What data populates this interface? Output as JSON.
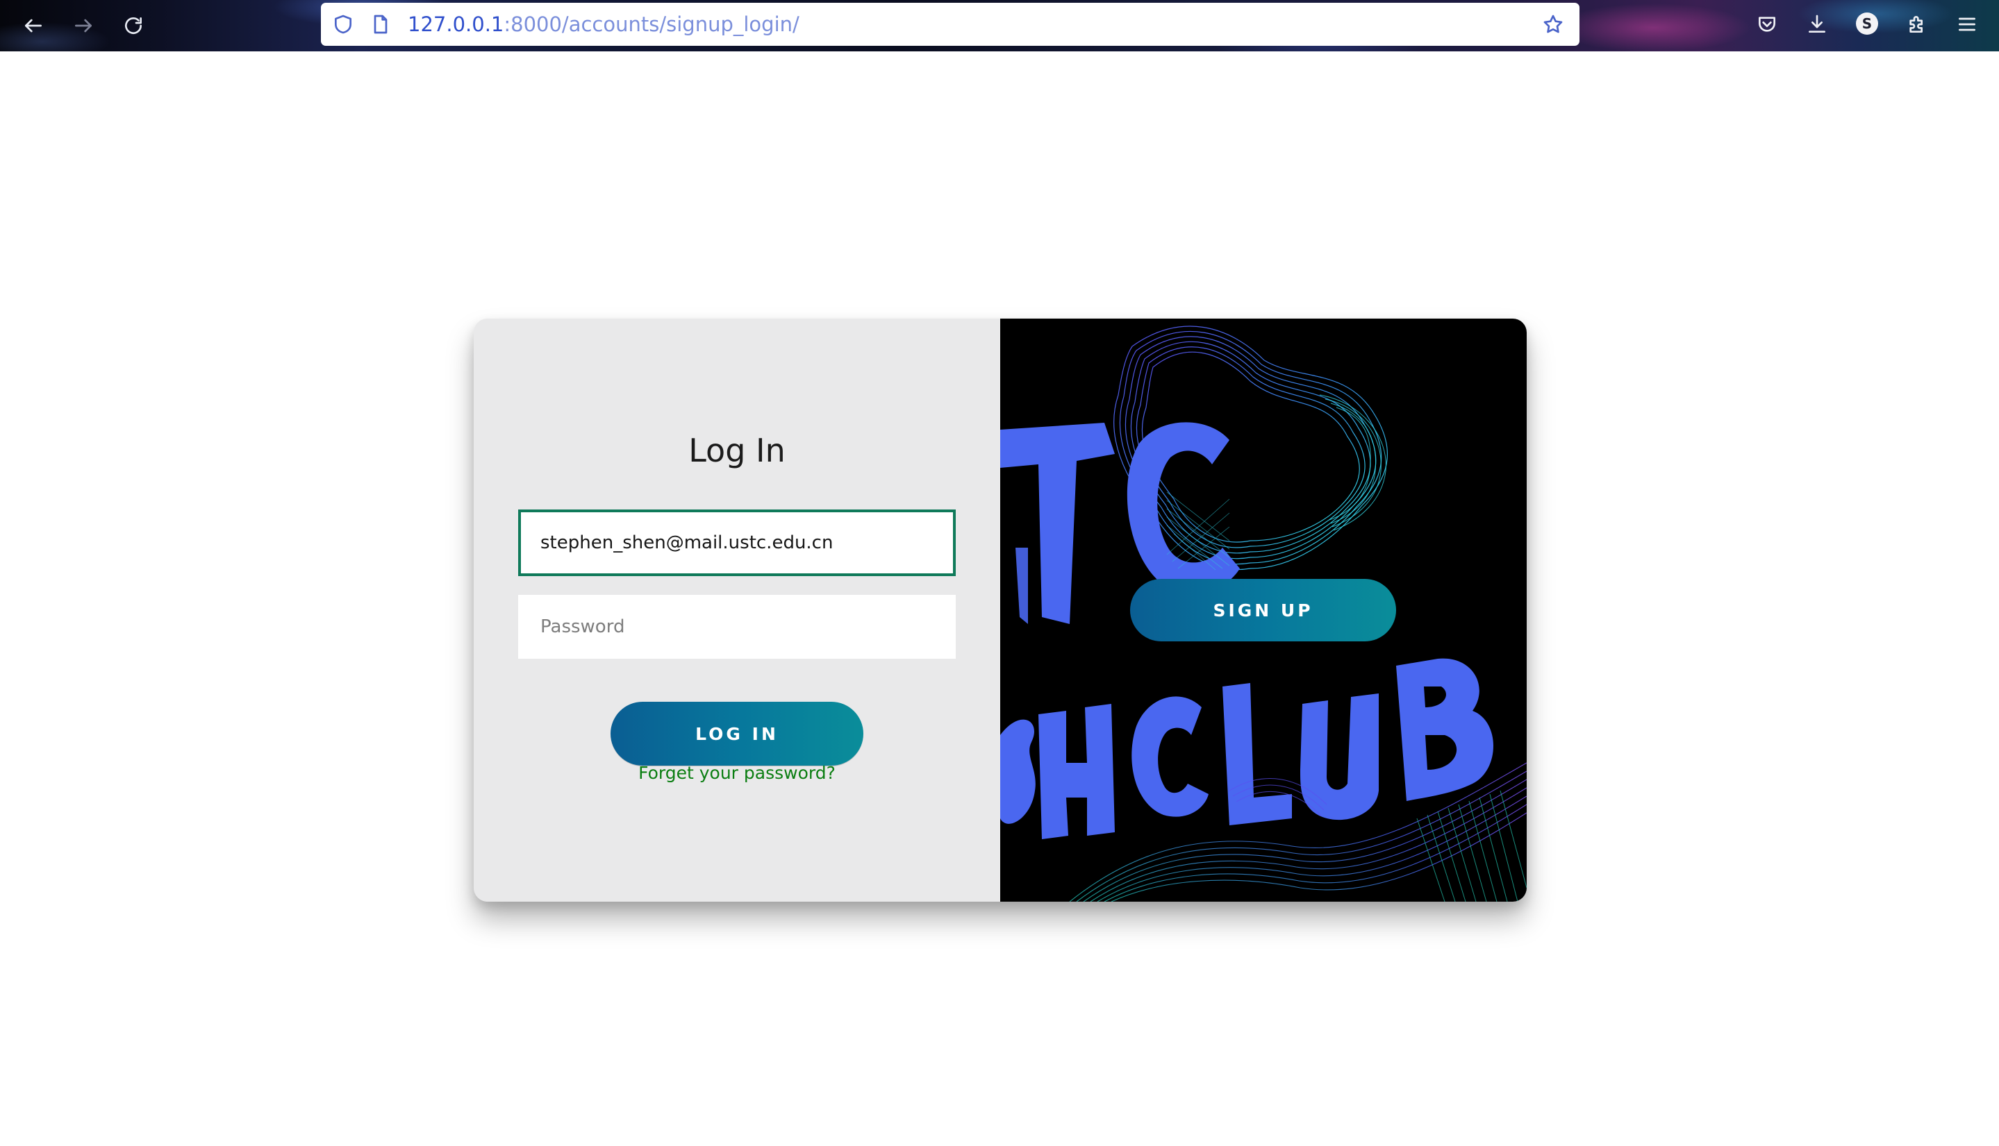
{
  "browser": {
    "url_host": "127.0.0.1",
    "url_path": ":8000/accounts/signup_login/",
    "profile_initial": "S"
  },
  "login": {
    "title": "Log In",
    "email_value": "stephen_shen@mail.ustc.edu.cn",
    "password_placeholder": "Password",
    "login_button": "LOG IN",
    "forgot_link": "Forget your password?"
  },
  "signup": {
    "signup_button": "SIGN UP"
  },
  "colors": {
    "accent_gradient_start": "#0a5e93",
    "accent_gradient_end": "#0a8d9a",
    "link_green": "#0b7e12",
    "focus_border": "#0f7a5a",
    "poster_lettering": "#4a67f0",
    "poster_background": "#000000"
  }
}
